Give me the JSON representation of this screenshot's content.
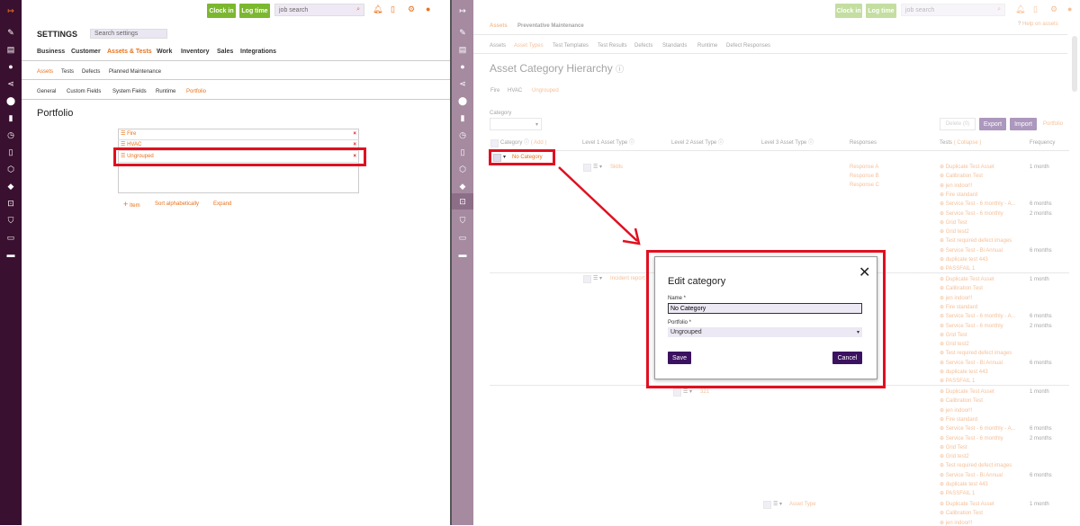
{
  "left": {
    "topbar": {
      "clock_in": "Clock in",
      "log_time": "Log time",
      "search_placeholder": "job search"
    },
    "settings_title": "SETTINGS",
    "settings_search_placeholder": "Search settings",
    "main_tabs": [
      "Business",
      "Customer",
      "Assets & Tests",
      "Work",
      "Inventory",
      "Sales",
      "Integrations"
    ],
    "sub_tabs": [
      "Assets",
      "Tests",
      "Defects",
      "Planned Maintenance"
    ],
    "sub_sub_tabs": [
      "General",
      "Custom Fields",
      "System Fields",
      "Runtime",
      "Portfolio"
    ],
    "page_title": "Portfolio",
    "portfolio_items": [
      "Fire",
      "HVAC",
      "Ungrouped"
    ],
    "actions": {
      "item": "Item",
      "sort": "Sort alphabetically",
      "expand": "Expand"
    }
  },
  "right": {
    "topbar": {
      "clock_in": "Clock in",
      "log_time": "Log time",
      "search_placeholder": "job search",
      "help": "Help on assets"
    },
    "tabs_top": [
      "Assets",
      "Preventative Maintenance"
    ],
    "tabs_second": [
      "Assets",
      "Asset Types",
      "Test Templates",
      "Test Results",
      "Defects",
      "Standards",
      "Runtime",
      "Defect Responses"
    ],
    "page_title": "Asset Category Hierarchy",
    "portfolio_filters": [
      "Fire",
      "HVAC",
      "Ungrouped"
    ],
    "category_label": "Category",
    "buttons": {
      "delete": "Delete (0)",
      "export": "Export",
      "import": "Import",
      "portfolio": "Portfolio"
    },
    "table_headers": {
      "category": "Category",
      "add": "Add",
      "level1": "Level 1 Asset Type",
      "level2": "Level 2 Asset Type",
      "level3": "Level 3 Asset Type",
      "responses": "Responses",
      "tests": "Tests",
      "collapse": "Collapse",
      "frequency": "Frequency"
    },
    "rows": {
      "category": "No Category",
      "skills": "Skills",
      "incident": "Incident report",
      "num": "321",
      "asset_type": "Asset Type"
    },
    "responses": [
      "Response A",
      "Response B",
      "Response C"
    ],
    "test_group_1": [
      {
        "name": "Duplicate Test Asset",
        "freq": "1 month"
      },
      {
        "name": "Calibration Test",
        "freq": ""
      },
      {
        "name": "jen indoor!!",
        "freq": ""
      },
      {
        "name": "Fire standard",
        "freq": ""
      },
      {
        "name": "Service Test - 6 monthly - A...",
        "freq": "6 months"
      },
      {
        "name": "Service Test - 6 monthly",
        "freq": "2 months"
      },
      {
        "name": "Grid Test",
        "freq": ""
      },
      {
        "name": "Grid test2",
        "freq": ""
      },
      {
        "name": "Test required defect images",
        "freq": ""
      },
      {
        "name": "Service Test - Bi Annual",
        "freq": "6 months"
      },
      {
        "name": "duplicate test 443",
        "freq": ""
      },
      {
        "name": "PASSFAIL 1",
        "freq": ""
      }
    ],
    "test_group_4": [
      {
        "name": "Duplicate Test Asset",
        "freq": "1 month"
      },
      {
        "name": "Calibration Test",
        "freq": ""
      },
      {
        "name": "jen indoor!!",
        "freq": ""
      }
    ]
  },
  "modal": {
    "title": "Edit category",
    "name_label": "Name *",
    "name_value": "No Category",
    "portfolio_label": "Portfolio *",
    "portfolio_value": "Ungrouped",
    "save": "Save",
    "cancel": "Cancel"
  }
}
